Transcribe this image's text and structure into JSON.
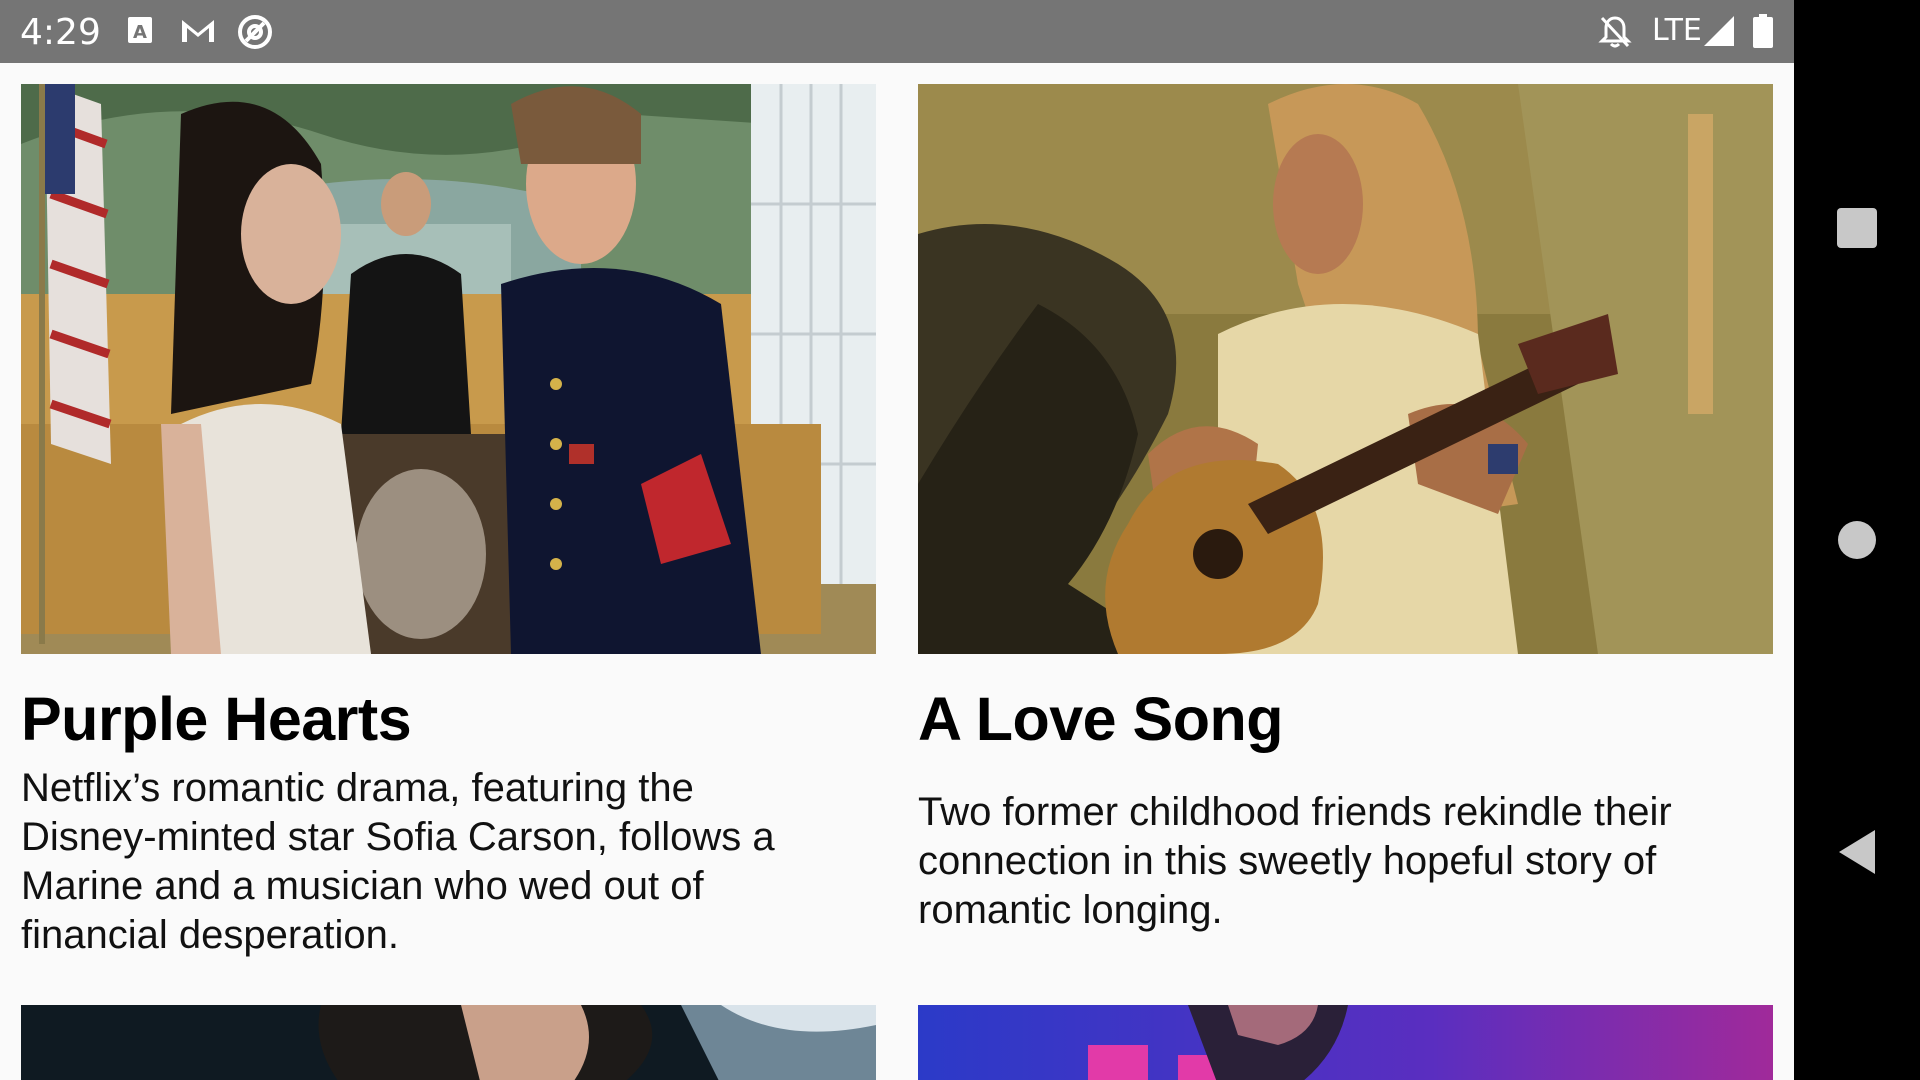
{
  "status_bar": {
    "time": "4:29",
    "network": "LTE",
    "icons": [
      "a-icon",
      "gmail-icon",
      "at-sign-icon",
      "notifications-off-icon",
      "signal-icon",
      "battery-icon"
    ]
  },
  "cards": [
    {
      "title": "Purple Hearts",
      "description": "Netflix’s romantic drama, featuring the Disney-minted star Sofia Carson, follows a Marine and a musician who wed out of financial desperation.",
      "image": "courtroom-wedding-photo"
    },
    {
      "title": "A Love Song",
      "description": "Two former childhood friends rekindle their connection in this sweetly hopeful story of romantic longing.",
      "image": "woman-playing-guitar-photo"
    }
  ],
  "navigation": {
    "buttons": [
      "recents-button",
      "home-button",
      "back-button"
    ]
  }
}
